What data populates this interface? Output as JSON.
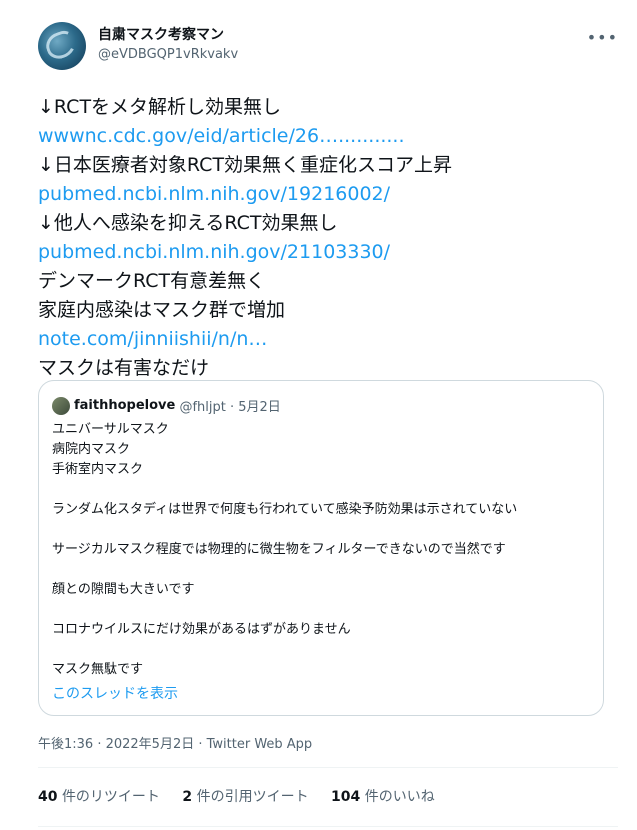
{
  "author": {
    "display_name": "自粛マスク考察マン",
    "handle": "@eVDBGQP1vRkvakv"
  },
  "more_icon": "more-horizontal-icon",
  "tweet_lines": [
    {
      "text": "↓RCTをメタ解析し効果無し",
      "link": false
    },
    {
      "text": "wwwnc.cdc.gov/eid/article/26…...........",
      "link": true
    },
    {
      "text": "↓日本医療者対象RCT効果無く重症化スコア上昇",
      "link": false
    },
    {
      "text": "pubmed.ncbi.nlm.nih.gov/19216002/",
      "link": true
    },
    {
      "text": "↓他人へ感染を抑えるRCT効果無し",
      "link": false
    },
    {
      "text": "pubmed.ncbi.nlm.nih.gov/21103330/",
      "link": true
    },
    {
      "text": "デンマークRCT有意差無く",
      "link": false
    },
    {
      "text": "家庭内感染はマスク群で増加",
      "link": false
    },
    {
      "text": "note.com/jinniishii/n/n…",
      "link": true
    },
    {
      "text": "マスクは有害なだけ",
      "link": false
    }
  ],
  "quote": {
    "name": "faithhopelove",
    "meta": "@fhljpt · 5月2日",
    "lines": [
      "ユニバーサルマスク",
      "病院内マスク",
      "手術室内マスク",
      "",
      "ランダム化スタディは世界で何度も行われていて感染予防効果は示されていない",
      "",
      "サージカルマスク程度では物理的に微生物をフィルターできないので当然です",
      "",
      "顔との隙間も大きいです",
      "",
      "コロナウイルスにだけ効果があるはずがありません",
      "",
      "マスク無駄です"
    ],
    "show_thread": "このスレッドを表示"
  },
  "timestamp": "午後1:36 · 2022年5月2日 · Twitter Web App",
  "stats": {
    "retweets_count": "40",
    "retweets_label": "件のリツイート",
    "quotes_count": "2",
    "quotes_label": "件の引用ツイート",
    "likes_count": "104",
    "likes_label": "件のいいね"
  },
  "colors": {
    "link": "#1d9bf0",
    "text": "#0f1419",
    "muted": "#536471",
    "border": "#cfd9de"
  }
}
